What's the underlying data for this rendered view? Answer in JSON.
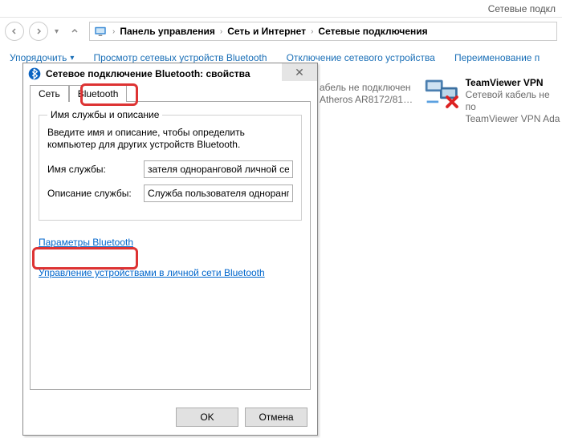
{
  "window": {
    "title_partial": "Сетевые подкл"
  },
  "breadcrumbs": {
    "items": [
      "Панель управления",
      "Сеть и Интернет",
      "Сетевые подключения"
    ]
  },
  "toolbar": {
    "arrange": "Упорядочить",
    "view_bt": "Просмотр сетевых устройств Bluetooth",
    "disable": "Отключение сетевого устройства",
    "rename": "Переименование п"
  },
  "connections": {
    "item1": {
      "name_partial": "абель не подключен",
      "adapter_partial": "Atheros AR8172/81…"
    },
    "item2": {
      "name": "TeamViewer VPN",
      "status": "Сетевой кабель не по",
      "adapter": "TeamViewer VPN Ada"
    }
  },
  "dialog": {
    "title": "Сетевое подключение Bluetooth: свойства",
    "close_glyph": "✕",
    "tabs": {
      "network": "Сеть",
      "bluetooth": "Bluetooth"
    },
    "group": {
      "legend": "Имя службы и описание",
      "desc": "Введите имя и описание, чтобы определить компьютер для других устройств Bluetooth."
    },
    "fields": {
      "name_label": "Имя службы:",
      "name_value": "зателя одноранговой личной сети",
      "desc_label": "Описание службы:",
      "desc_value": "Служба пользователя однорангов"
    },
    "links": {
      "bt_params": "Параметры Bluetooth",
      "pan_mgmt": "Управление устройствами в личной сети Bluetooth"
    },
    "buttons": {
      "ok": "OK",
      "cancel": "Отмена"
    }
  }
}
